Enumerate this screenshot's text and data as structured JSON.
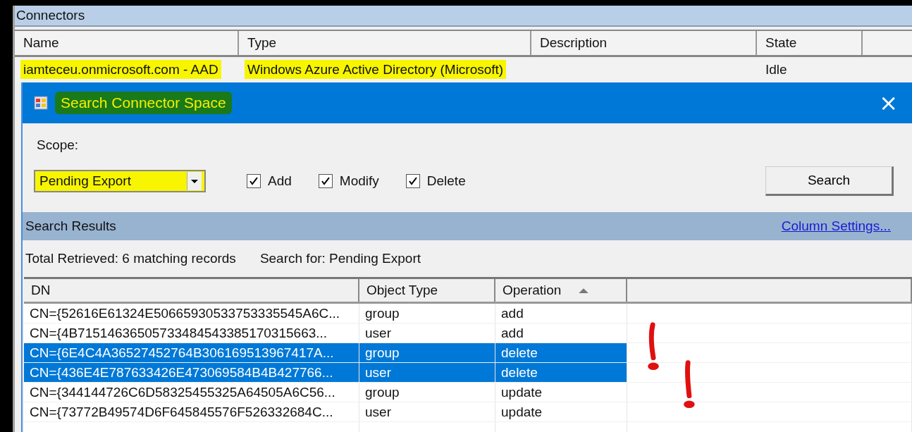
{
  "panel": {
    "title": "Connectors"
  },
  "connectors": {
    "columns": [
      "Name",
      "Type",
      "Description",
      "State"
    ],
    "rows": [
      {
        "cells": [
          "iamteceu.onmicrosoft.com - AAD",
          "Windows Azure Active Directory (Microsoft)",
          "",
          "Idle"
        ],
        "highlighted": true
      }
    ]
  },
  "dialog": {
    "title": "Search Connector Space",
    "title_highlighted": true,
    "close": "×",
    "scope_label": "Scope:",
    "scope": {
      "value": "Pending Export",
      "highlighted": true
    },
    "checkboxes": [
      {
        "label": "Add",
        "checked": true
      },
      {
        "label": "Modify",
        "checked": true
      },
      {
        "label": "Delete",
        "checked": true
      }
    ],
    "search_button": "Search",
    "results_title": "Search Results",
    "column_settings_link": "Column Settings...",
    "total": "Total Retrieved: 6 matching records",
    "search_for": "Search for: Pending Export",
    "results": {
      "columns": [
        {
          "label": "DN",
          "sorted": false
        },
        {
          "label": "Object Type",
          "sorted": false
        },
        {
          "label": "Operation",
          "sorted": true
        }
      ],
      "rows": [
        {
          "cells": [
            "CN={52616E61324E50665930533753335545A6C...",
            "group",
            "add"
          ],
          "selected": false
        },
        {
          "cells": [
            "CN={4B71514636505733484543385170315663...",
            "user",
            "add"
          ],
          "selected": false
        },
        {
          "cells": [
            "CN={6E4C4A36527452764B306169513967417A...",
            "group",
            "delete"
          ],
          "selected": true
        },
        {
          "cells": [
            "CN={436E4E787633426E473069584B4B427766...",
            "user",
            "delete"
          ],
          "selected": true
        },
        {
          "cells": [
            "CN={344144726C6D58325455325A64505A6C56...",
            "group",
            "update"
          ],
          "selected": false
        },
        {
          "cells": [
            "CN={73772B49574D6F645845576F526332684C...",
            "user",
            "update"
          ],
          "selected": false
        }
      ]
    }
  }
}
